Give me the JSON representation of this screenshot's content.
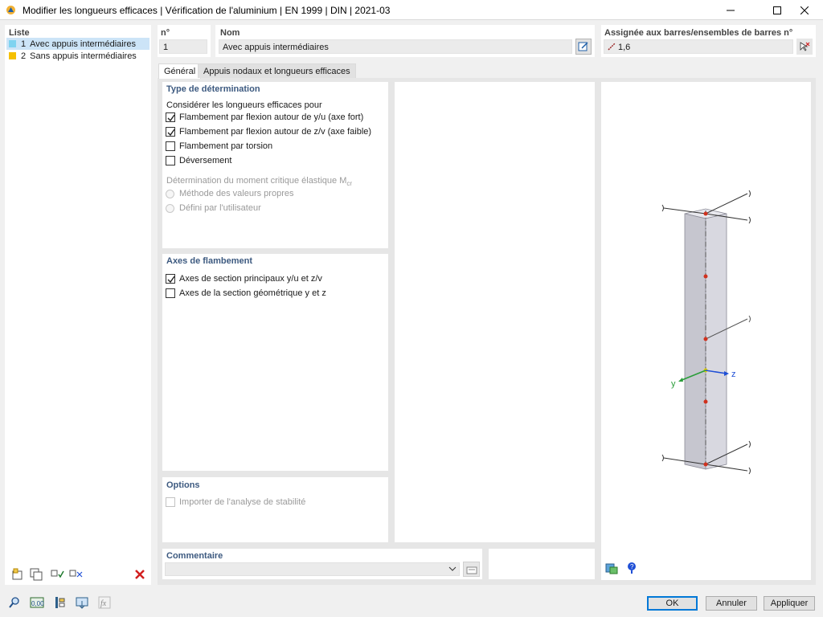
{
  "window": {
    "title": "Modifier les longueurs efficaces | Vérification de l'aluminium | EN 1999 | DIN | 2021-03"
  },
  "list": {
    "heading": "Liste",
    "items": [
      {
        "num": "1",
        "label": "Avec appuis intermédiaires",
        "color": "#7fd3f0",
        "selected": true
      },
      {
        "num": "2",
        "label": "Sans appuis intermédiaires",
        "color": "#f5c000",
        "selected": false
      }
    ]
  },
  "header": {
    "num_label": "n°",
    "num_value": "1",
    "name_label": "Nom",
    "name_value": "Avec appuis intermédiaires",
    "assigned_label": "Assignée aux barres/ensembles de barres n°",
    "assigned_value": "1,6"
  },
  "tabs": [
    {
      "label": "Général",
      "active": true
    },
    {
      "label": "Appuis nodaux et longueurs efficaces",
      "active": false
    }
  ],
  "type_determination": {
    "title": "Type de détermination",
    "subtitle": "Considérer les longueurs efficaces pour",
    "checks": [
      {
        "label": "Flambement par flexion autour de y/u (axe fort)",
        "checked": true
      },
      {
        "label": "Flambement par flexion autour de z/v (axe faible)",
        "checked": true
      },
      {
        "label": "Flambement par torsion",
        "checked": false
      },
      {
        "label": "Déversement",
        "checked": false
      }
    ],
    "moment_label": "Détermination du moment critique élastique M",
    "moment_sub": "cr",
    "radios": [
      {
        "label": "Méthode des valeurs propres"
      },
      {
        "label": "Défini par l'utilisateur"
      }
    ]
  },
  "axes": {
    "title": "Axes de flambement",
    "checks": [
      {
        "label": "Axes de section principaux y/u et z/v",
        "checked": true
      },
      {
        "label": "Axes de la section géométrique y et z",
        "checked": false
      }
    ]
  },
  "options": {
    "title": "Options",
    "import_label": "Importer de l'analyse de stabilité"
  },
  "comment": {
    "title": "Commentaire",
    "value": ""
  },
  "preview": {
    "axis_y": "y",
    "axis_z": "z",
    "colors": {
      "axis_y": "#2a9d3a",
      "axis_z": "#1f4fd6",
      "node": "#d0311e",
      "member": "#c9c9d2"
    }
  },
  "buttons": {
    "ok": "OK",
    "cancel": "Annuler",
    "apply": "Appliquer"
  }
}
